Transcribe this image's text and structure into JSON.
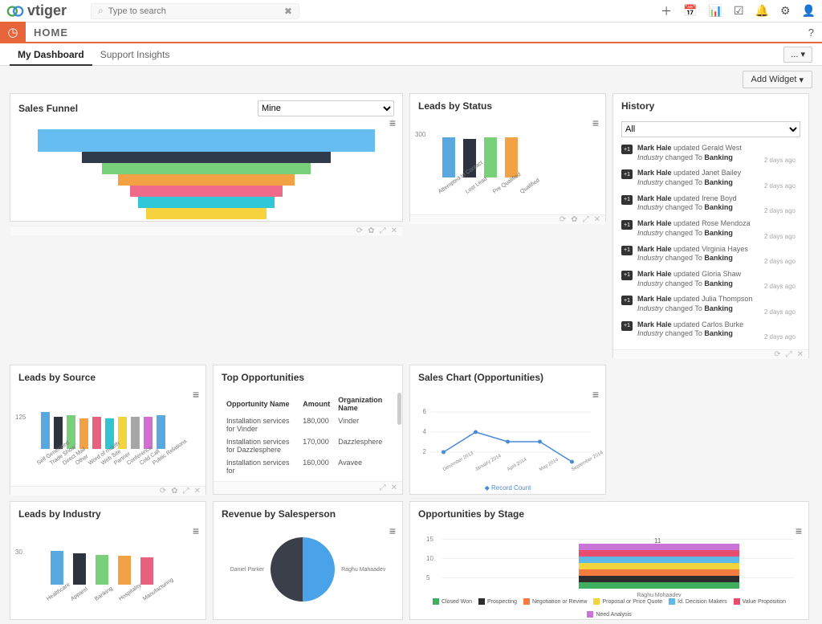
{
  "app": {
    "name": "vtiger",
    "home_label": "HOME"
  },
  "search": {
    "placeholder": "Type to search"
  },
  "tabs": {
    "my_dashboard": "My Dashboard",
    "support_insights": "Support Insights",
    "add_widget": "Add Widget",
    "more": "..."
  },
  "widgets": {
    "sales_funnel": {
      "title": "Sales Funnel",
      "filter": "Mine"
    },
    "leads_status": {
      "title": "Leads by Status"
    },
    "history": {
      "title": "History",
      "filter": "All",
      "time": "2 days ago",
      "items": [
        {
          "actor": "Mark Hale",
          "action": "updated",
          "target": "Gerald West",
          "field": "Industry",
          "value": "Banking"
        },
        {
          "actor": "Mark Hale",
          "action": "updated",
          "target": "Janet Bailey",
          "field": "Industry",
          "value": "Banking"
        },
        {
          "actor": "Mark Hale",
          "action": "updated",
          "target": "Irene Boyd",
          "field": "Industry",
          "value": "Banking"
        },
        {
          "actor": "Mark Hale",
          "action": "updated",
          "target": "Rose Mendoza",
          "field": "Industry",
          "value": "Banking"
        },
        {
          "actor": "Mark Hale",
          "action": "updated",
          "target": "Virginia Hayes",
          "field": "Industry",
          "value": "Banking"
        },
        {
          "actor": "Mark Hale",
          "action": "updated",
          "target": "Gloria Shaw",
          "field": "Industry",
          "value": "Banking"
        },
        {
          "actor": "Mark Hale",
          "action": "updated",
          "target": "Julia Thompson",
          "field": "Industry",
          "value": "Banking"
        },
        {
          "actor": "Mark Hale",
          "action": "updated",
          "target": "Carlos Burke",
          "field": "Industry",
          "value": "Banking"
        }
      ],
      "changed_to": " changed To "
    },
    "leads_source": {
      "title": "Leads by Source"
    },
    "top_opp": {
      "title": "Top Opportunities",
      "cols": {
        "c1": "Opportunity Name",
        "c2": "Amount",
        "c3": "Organization Name"
      },
      "rows": [
        {
          "name": "Installation services for Vinder",
          "amount": "180,000",
          "org": "Vinder"
        },
        {
          "name": "Installation services for Dazzlesphere",
          "amount": "170,000",
          "org": "Dazzlesphere"
        },
        {
          "name": "Installation services for",
          "amount": "160,000",
          "org": "Avavee"
        }
      ]
    },
    "sales_chart": {
      "title": "Sales Chart (Opportunities)",
      "legend": "Record Count"
    },
    "leads_industry": {
      "title": "Leads by Industry"
    },
    "revenue_sp": {
      "title": "Revenue by Salesperson",
      "left": "Daniel Parker",
      "right": "Raghu Mahaadev"
    },
    "opp_stage": {
      "title": "Opportunities by Stage",
      "xlabel": "Raghu Mohaadev",
      "annotation": "11",
      "legend": {
        "closed_won": "Closed Won",
        "prospecting": "Prospecting",
        "neg": "Negotiation or Review",
        "ppq": "Proposal or Price Quote",
        "idm": "Id. Decision Makers",
        "vp": "Value Proposition",
        "na": "Need Analysis"
      }
    }
  },
  "chart_data": [
    {
      "type": "bar",
      "widget": "leads_status",
      "ylim": [
        0,
        300
      ],
      "tick": 300,
      "categories": [
        "Attempted to Contact",
        "Lost Lead",
        "Pre Qualified",
        "Qualified"
      ],
      "values": [
        250,
        240,
        250,
        250
      ],
      "colors": [
        "#5aa8e0",
        "#2d3440",
        "#78d07a",
        "#f2a145"
      ]
    },
    {
      "type": "bar",
      "widget": "leads_source",
      "ylim": [
        0,
        125
      ],
      "tick": 125,
      "categories": [
        "Self Generated",
        "Trade Show",
        "Direct Mail",
        "Other",
        "Word of mouth",
        "Web Site",
        "Partner",
        "Conference",
        "Cold Call",
        "Public Relations"
      ],
      "values": [
        115,
        100,
        105,
        95,
        100,
        95,
        100,
        100,
        100,
        105
      ],
      "colors": [
        "#5aa8e0",
        "#2d3440",
        "#78d07a",
        "#f2a145",
        "#e8627f",
        "#33c3d1",
        "#f2d43e",
        "#a6a6a6",
        "#d46fd1",
        "#5aa8e0"
      ]
    },
    {
      "type": "line",
      "widget": "sales_chart",
      "ylim": [
        0,
        6
      ],
      "yticks": [
        2,
        4,
        6
      ],
      "categories": [
        "December 2013",
        "January 2014",
        "April 2014",
        "May 2014",
        "September 2014"
      ],
      "series": [
        {
          "name": "Record Count",
          "values": [
            2,
            4,
            3,
            3,
            1
          ]
        }
      ]
    },
    {
      "type": "bar",
      "widget": "leads_industry",
      "ylim": [
        0,
        30
      ],
      "tick": 30,
      "categories": [
        "Healthcare",
        "Apparel",
        "Banking",
        "Hospitality",
        "Manufacturing"
      ],
      "values": [
        28,
        26,
        25,
        24,
        23
      ],
      "colors": [
        "#5aa8e0",
        "#2d3440",
        "#78d07a",
        "#f2a145",
        "#e8627f"
      ]
    },
    {
      "type": "pie",
      "widget": "revenue_sp",
      "series": [
        {
          "name": "Daniel Parker",
          "value": 50
        },
        {
          "name": "Raghu Mahaadev",
          "value": 50
        }
      ]
    },
    {
      "type": "bar-stacked",
      "widget": "opp_stage",
      "ylim": [
        0,
        15
      ],
      "yticks": [
        5,
        10,
        15
      ],
      "categories": [
        "Raghu Mohaadev"
      ],
      "series": [
        {
          "name": "Closed Won",
          "values": [
            1.5
          ],
          "color": "#3fae5f"
        },
        {
          "name": "Prospecting",
          "values": [
            1.5
          ],
          "color": "#2d2d2d"
        },
        {
          "name": "Negotiation or Review",
          "values": [
            1.5
          ],
          "color": "#f57c3e"
        },
        {
          "name": "Proposal or Price Quote",
          "values": [
            1.5
          ],
          "color": "#f2d43e"
        },
        {
          "name": "Id. Decision Makers",
          "values": [
            1.5
          ],
          "color": "#5fb8e8"
        },
        {
          "name": "Value Proposition",
          "values": [
            1.5
          ],
          "color": "#e84d6f"
        },
        {
          "name": "Need Analysis",
          "values": [
            2.0
          ],
          "color": "#c974d6"
        }
      ]
    }
  ]
}
